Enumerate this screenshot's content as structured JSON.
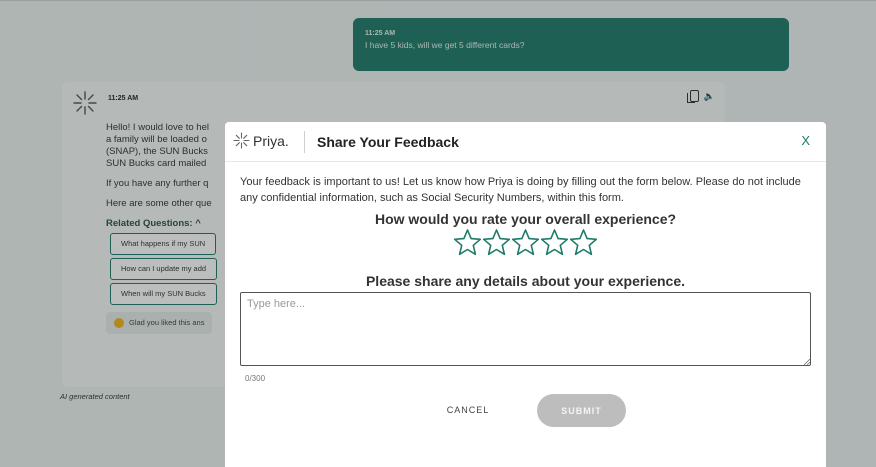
{
  "colors": {
    "accent": "#1f7a69",
    "submit_disabled": "#bdbdbd",
    "overlay": "rgba(30,40,38,0.30)"
  },
  "chat": {
    "user_message": {
      "time": "11:25 AM",
      "text": "I have 5 kids, will we get 5 different cards?"
    },
    "bot_message": {
      "time": "11:25 AM",
      "paragraph1_lines": [
        "Hello! I would love to hel",
        "a family will be loaded o",
        "(SNAP), the SUN Bucks",
        "SUN Bucks card mailed"
      ],
      "paragraph2": "If you have any further q",
      "paragraph3": "Here are some other que",
      "related_title": "Related Questions:",
      "related_chevron": "^",
      "related_questions": [
        "What happens if my SUN",
        "How can I update my add",
        "When will my SUN Bucks"
      ],
      "glad_text": "Glad you liked this ans",
      "icons": [
        "copy-icon",
        "speaker-icon"
      ]
    },
    "ai_note": "AI generated content"
  },
  "modal": {
    "brand_name": "Priya.",
    "title": "Share Your Feedback",
    "close_label": "X",
    "intro": "Your feedback is important to us! Let us know how Priya is doing by filling out the form below. Please do not include any confidential information, such as Social Security Numbers, within this form.",
    "rating_question": "How would you rate your overall experience?",
    "rating": {
      "value": 0,
      "max": 5
    },
    "details_question": "Please share any details about your experience.",
    "details_value": "",
    "details_placeholder": "Type here...",
    "counter": "0/300",
    "cancel_label": "CANCEL",
    "submit_label": "SUBMIT"
  }
}
